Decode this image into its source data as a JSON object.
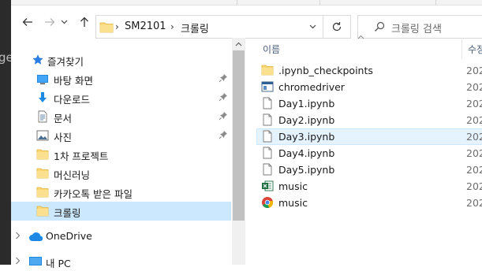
{
  "background_app": {
    "ghost_text": "ge"
  },
  "toolbar": {
    "back_icon": "arrow-left-icon",
    "forward_icon": "arrow-right-icon",
    "recent_icon": "chevron-down-icon",
    "up_icon": "arrow-up-icon"
  },
  "address": {
    "crumbs": [
      "SM2101",
      "크롤링"
    ],
    "separator": "›"
  },
  "search": {
    "placeholder": "크롤링 검색"
  },
  "nav_pane": {
    "quick_access": "즐겨찾기",
    "items": [
      {
        "label": "바탕 화면",
        "icon": "desktop-icon",
        "pinned": true
      },
      {
        "label": "다운로드",
        "icon": "download-icon",
        "pinned": true
      },
      {
        "label": "문서",
        "icon": "document-icon",
        "pinned": true
      },
      {
        "label": "사진",
        "icon": "pictures-icon",
        "pinned": true
      },
      {
        "label": "1차 프로젝트",
        "icon": "folder-icon",
        "pinned": false
      },
      {
        "label": "머신러닝",
        "icon": "folder-icon",
        "pinned": false
      },
      {
        "label": "카카오톡 받은 파일",
        "icon": "folder-icon",
        "pinned": false
      },
      {
        "label": "크롤링",
        "icon": "folder-icon",
        "pinned": false,
        "selected": true
      }
    ],
    "onedrive": "OneDrive",
    "this_pc": "내 PC"
  },
  "file_list": {
    "columns": {
      "name": "이름",
      "date": "수정"
    },
    "files": [
      {
        "name": ".ipynb_checkpoints",
        "icon": "folder-icon",
        "date": "202"
      },
      {
        "name": "chromedriver",
        "icon": "exe-icon",
        "date": "202"
      },
      {
        "name": "Day1.ipynb",
        "icon": "file-icon",
        "date": "202"
      },
      {
        "name": "Day2.ipynb",
        "icon": "file-icon",
        "date": "202"
      },
      {
        "name": "Day3.ipynb",
        "icon": "file-icon",
        "date": "202",
        "hovered": true
      },
      {
        "name": "Day4.ipynb",
        "icon": "file-icon",
        "date": "202"
      },
      {
        "name": "Day5.ipynb",
        "icon": "file-icon",
        "date": "202"
      },
      {
        "name": "music",
        "icon": "excel-icon",
        "date": "202"
      },
      {
        "name": "music",
        "icon": "chrome-icon",
        "date": "202"
      }
    ]
  },
  "colors": {
    "selected_bg": "#cce8ff",
    "hover_bg": "#e5f3ff",
    "folder": "#f8d775",
    "header_text": "#4c607a"
  }
}
